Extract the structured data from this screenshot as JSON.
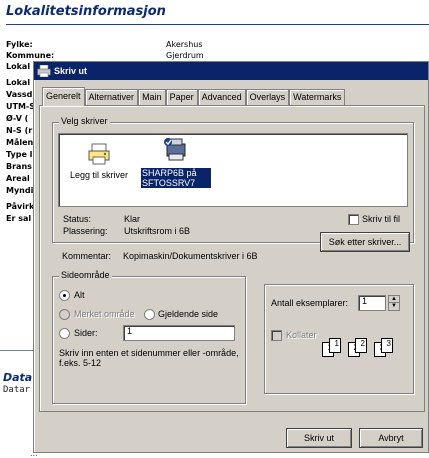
{
  "background": {
    "title": "Lokalitetsinformasjon",
    "fields": [
      {
        "label": "Fylke:",
        "value": "Akershus"
      },
      {
        "label": "Kommune:",
        "value": "Gjerdrum"
      },
      {
        "label": "Lokal",
        "value": ""
      },
      {
        "label": "Lokal",
        "value": ""
      },
      {
        "label": "Vassd",
        "value": ""
      },
      {
        "label": "UTM-S",
        "value": ""
      },
      {
        "label": "Ø-V (",
        "value": ""
      },
      {
        "label": "N-S (r",
        "value": ""
      },
      {
        "label": "Målen",
        "value": ""
      },
      {
        "label": "Type l",
        "value": ""
      },
      {
        "label": "Brans",
        "value": ""
      },
      {
        "label": "Areal",
        "value": ""
      },
      {
        "label": "Myndi",
        "value": ""
      },
      {
        "label": "Påvirk",
        "value": ""
      },
      {
        "label": "Er sal",
        "value": ""
      }
    ],
    "data_title": "Data",
    "data_text": "Datar",
    "footer": "..."
  },
  "dialog": {
    "title": "Skriv ut",
    "tabs": [
      "Generelt",
      "Alternativer",
      "Main",
      "Paper",
      "Advanced",
      "Overlays",
      "Watermarks"
    ],
    "active_tab": "Generelt",
    "printer_group": {
      "legend": "Velg skriver",
      "printers": [
        {
          "name": "Legg til skriver",
          "icon": "add-printer-icon"
        },
        {
          "name": "SHARP6B på SFTOSSRV7",
          "icon": "printer-icon",
          "selected": true
        }
      ],
      "status_label": "Status:",
      "status_value": "Klar",
      "location_label": "Plassering:",
      "location_value": "Utskriftsrom i 6B",
      "comment_label": "Kommentar:",
      "comment_value": "Kopimaskin/Dokumentskriver i 6B",
      "print_to_file": "Skriv til fil",
      "find_printer_button": "Søk etter skriver..."
    },
    "page_range": {
      "legend": "Sideområde",
      "all": "Alt",
      "selection": "Merket område",
      "current_page": "Gjeldende side",
      "pages": "Sider:",
      "pages_value": "1",
      "hint": "Skriv inn enten et sidenummer eller -område, f.eks. 5-12",
      "selected_option": "Alt"
    },
    "copies": {
      "label": "Antall eksemplarer:",
      "value": "1",
      "collate": "Kollater",
      "collate_pages": [
        "1",
        "1",
        "2",
        "2",
        "3",
        "3"
      ]
    },
    "buttons": {
      "print": "Skriv ut",
      "cancel": "Avbryt"
    }
  },
  "colors": {
    "titlebar": "#0a246a",
    "dialog_face": "#d4d0c8",
    "page_heading": "#0b2a70"
  }
}
